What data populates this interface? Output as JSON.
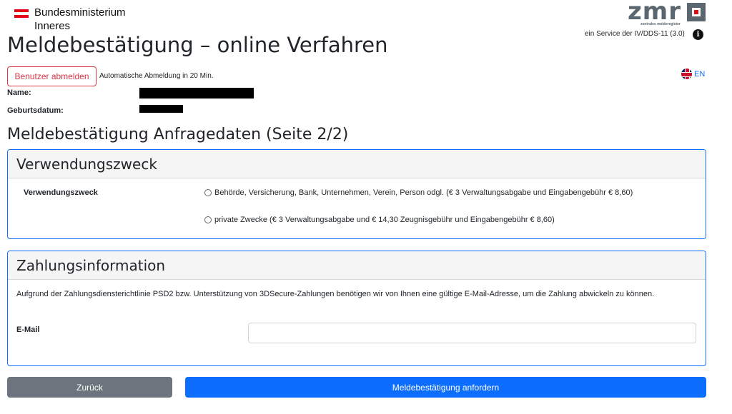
{
  "header": {
    "ministry_line1": "Bundesministerium",
    "ministry_line2": "Inneres",
    "zmr_logo": "zmr",
    "zmr_subtitle": "zentrales melderegister",
    "service": "ein Service der IV/DDS-11 (3.0)",
    "info_icon": "i"
  },
  "page_title": "Meldebestätigung – online Verfahren",
  "session": {
    "logout_label": "Benutzer abmelden",
    "auto_logout": "Automatische Abmeldung in 20 Min."
  },
  "language": {
    "label": "EN",
    "icon": "uk-flag-icon"
  },
  "person": {
    "name_label": "Name:",
    "birthdate_label": "Geburtsdatum:"
  },
  "section_title": "Meldebestätigung Anfragedaten (Seite 2/2)",
  "purpose_card": {
    "title": "Verwendungszweck",
    "field_label": "Verwendungszweck",
    "options": [
      {
        "label": "Behörde, Versicherung, Bank, Unternehmen, Verein, Person odgl. (€ 3 Verwaltungsabgabe und Eingabengebühr € 8,60)",
        "selected": false
      },
      {
        "label": "private Zwecke (€ 3 Verwaltungsabgabe und € 14,30 Zeugnisgebühr und Eingabengebühr € 8,60)",
        "selected": false
      }
    ]
  },
  "payment_card": {
    "title": "Zahlungsinformation",
    "text": "Aufgrund der Zahlungsdiensterichtlinie PSD2 bzw. Unterstützung von 3DSecure-Zahlungen benötigen wir von Ihnen eine gültige E-Mail-Adresse, um die Zahlung abwickeln zu können.",
    "email_label": "E-Mail",
    "email_value": "",
    "email_placeholder": ""
  },
  "actions": {
    "back_label": "Zurück",
    "submit_label": "Meldebestätigung anfordern"
  },
  "colors": {
    "primary": "#0d6efd",
    "danger": "#dc3545",
    "secondary": "#6c757d",
    "brand_red": "#e30613"
  }
}
